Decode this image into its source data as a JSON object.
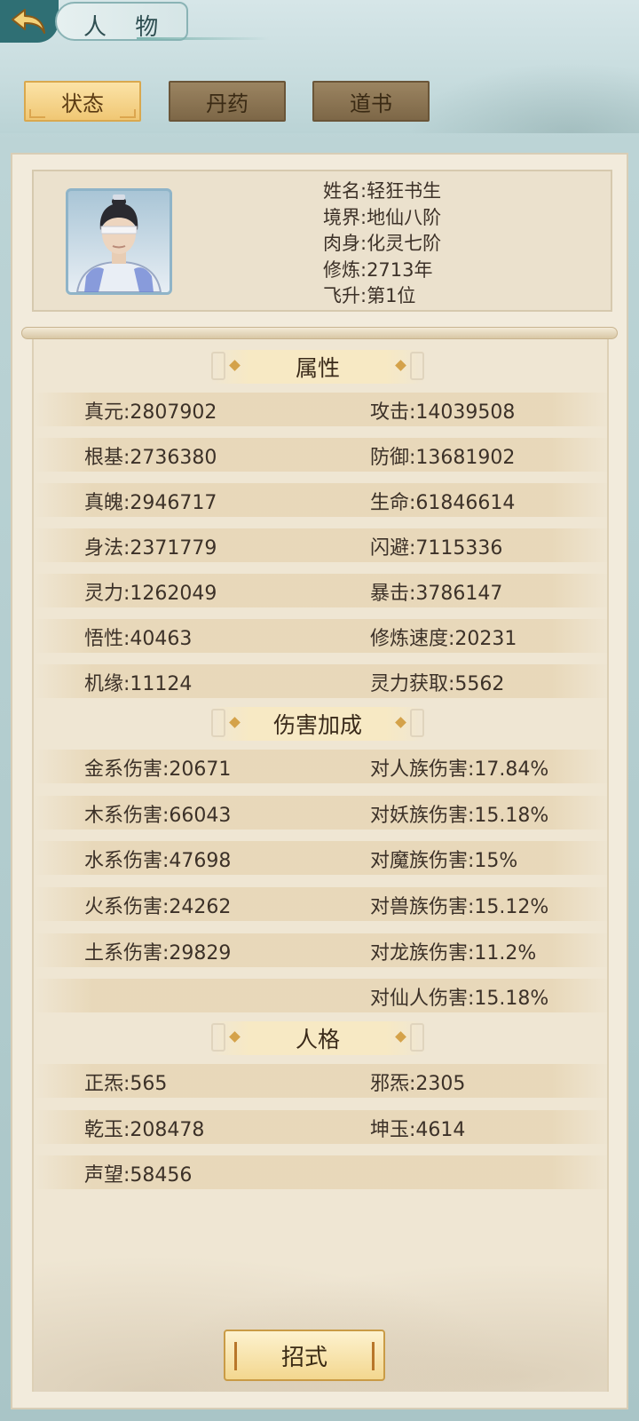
{
  "header": {
    "title": "人 物"
  },
  "tabs": [
    {
      "label": "状态",
      "active": true
    },
    {
      "label": "丹药",
      "active": false
    },
    {
      "label": "道书",
      "active": false
    }
  ],
  "profile": {
    "name": "姓名:轻狂书生",
    "realm": "境界:地仙八阶",
    "body": "肉身:化灵七阶",
    "cultivation": "修炼:2713年",
    "ascension": "飞升:第1位"
  },
  "sections": {
    "attributes": "属性",
    "damage_bonus": "伤害加成",
    "personality": "人格"
  },
  "attributes": [
    {
      "left": "真元:2807902",
      "right": "攻击:14039508"
    },
    {
      "left": "根基:2736380",
      "right": "防御:13681902"
    },
    {
      "left": "真魄:2946717",
      "right": "生命:61846614"
    },
    {
      "left": "身法:2371779",
      "right": "闪避:7115336"
    },
    {
      "left": "灵力:1262049",
      "right": "暴击:3786147"
    },
    {
      "left": "悟性:40463",
      "right": "修炼速度:20231"
    },
    {
      "left": "机缘:11124",
      "right": "灵力获取:5562"
    }
  ],
  "damage": [
    {
      "left": "金系伤害:20671",
      "right": "对人族伤害:17.84%"
    },
    {
      "left": "木系伤害:66043",
      "right": "对妖族伤害:15.18%"
    },
    {
      "left": "水系伤害:47698",
      "right": "对魔族伤害:15%"
    },
    {
      "left": "火系伤害:24262",
      "right": "对兽族伤害:15.12%"
    },
    {
      "left": "土系伤害:29829",
      "right": "对龙族伤害:11.2%"
    },
    {
      "left": "",
      "right": "对仙人伤害:15.18%"
    }
  ],
  "personality": [
    {
      "left": "正炁:565",
      "right": "邪炁:2305"
    },
    {
      "left": "乾玉:208478",
      "right": "坤玉:4614"
    },
    {
      "left": "声望:58456",
      "right": ""
    }
  ],
  "footer": {
    "moves_button": "招式"
  },
  "icons": {
    "back": "back-arrow-icon",
    "avatar": "character-portrait"
  },
  "colors": {
    "accent": "#2f6f74",
    "active_tab": "#f0c774",
    "inactive_tab": "#7d6747",
    "panel": "#f2ebdc"
  }
}
